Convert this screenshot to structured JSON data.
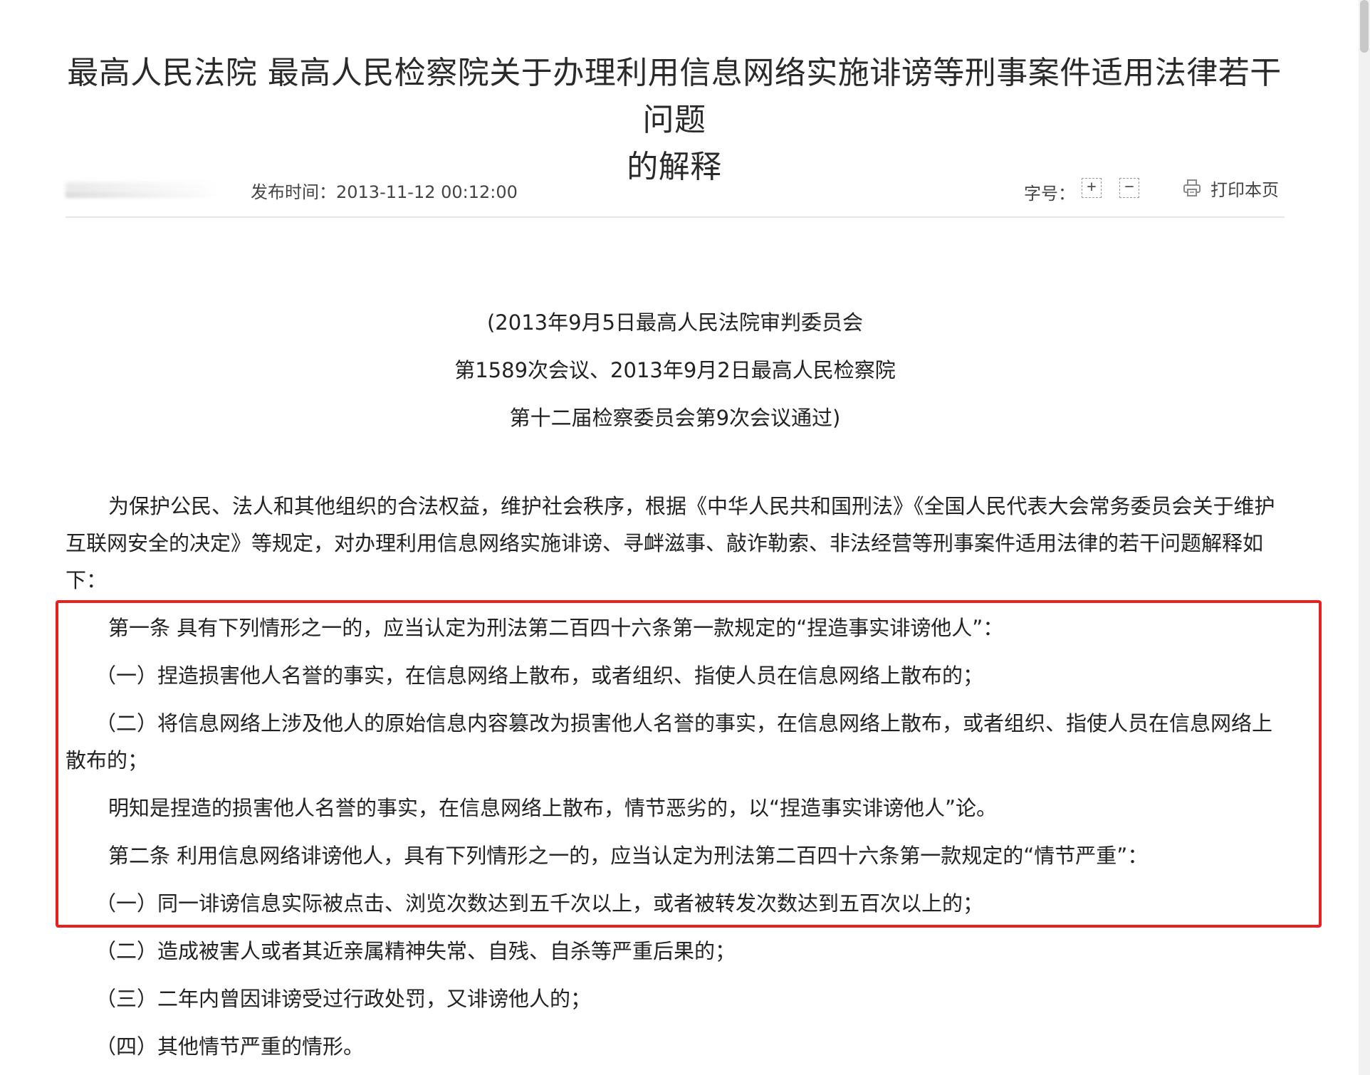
{
  "article": {
    "title_line1": "最高人民法院 最高人民检察院关于办理利用信息网络实施诽谤等刑事案件适用法律若干问题",
    "title_line2": "的解释"
  },
  "meta": {
    "publish_label": "发布时间：",
    "publish_time": "2013-11-12 00:12:00",
    "font_size_label": "字号：",
    "font_increase": "+",
    "font_decrease": "−",
    "print_label": "打印本页"
  },
  "approval": [
    "(2013年9月5日最高人民法院审判委员会",
    "第1589次会议、2013年9月2日最高人民检察院",
    "第十二届检察委员会第9次会议通过)"
  ],
  "paragraphs": [
    "为保护公民、法人和其他组织的合法权益，维护社会秩序，根据《中华人民共和国刑法》《全国人民代表大会常务委员会关于维护互联网安全的决定》等规定，对办理利用信息网络实施诽谤、寻衅滋事、敲诈勒索、非法经营等刑事案件适用法律的若干问题解释如下：",
    "第一条 具有下列情形之一的，应当认定为刑法第二百四十六条第一款规定的“捏造事实诽谤他人”：",
    "（一）捏造损害他人名誉的事实，在信息网络上散布，或者组织、指使人员在信息网络上散布的；",
    "（二）将信息网络上涉及他人的原始信息内容篡改为损害他人名誉的事实，在信息网络上散布，或者组织、指使人员在信息网络上散布的；",
    "明知是捏造的损害他人名誉的事实，在信息网络上散布，情节恶劣的，以“捏造事实诽谤他人”论。",
    "第二条 利用信息网络诽谤他人，具有下列情形之一的，应当认定为刑法第二百四十六条第一款规定的“情节严重”：",
    "（一）同一诽谤信息实际被点击、浏览次数达到五千次以上，或者被转发次数达到五百次以上的；",
    "（二）造成被害人或者其近亲属精神失常、自残、自杀等严重后果的；",
    "（三）二年内曾因诽谤受过行政处罚，又诽谤他人的；",
    "（四）其他情节严重的情形。"
  ],
  "colors": {
    "highlight": "#e82020",
    "text": "#222222"
  }
}
